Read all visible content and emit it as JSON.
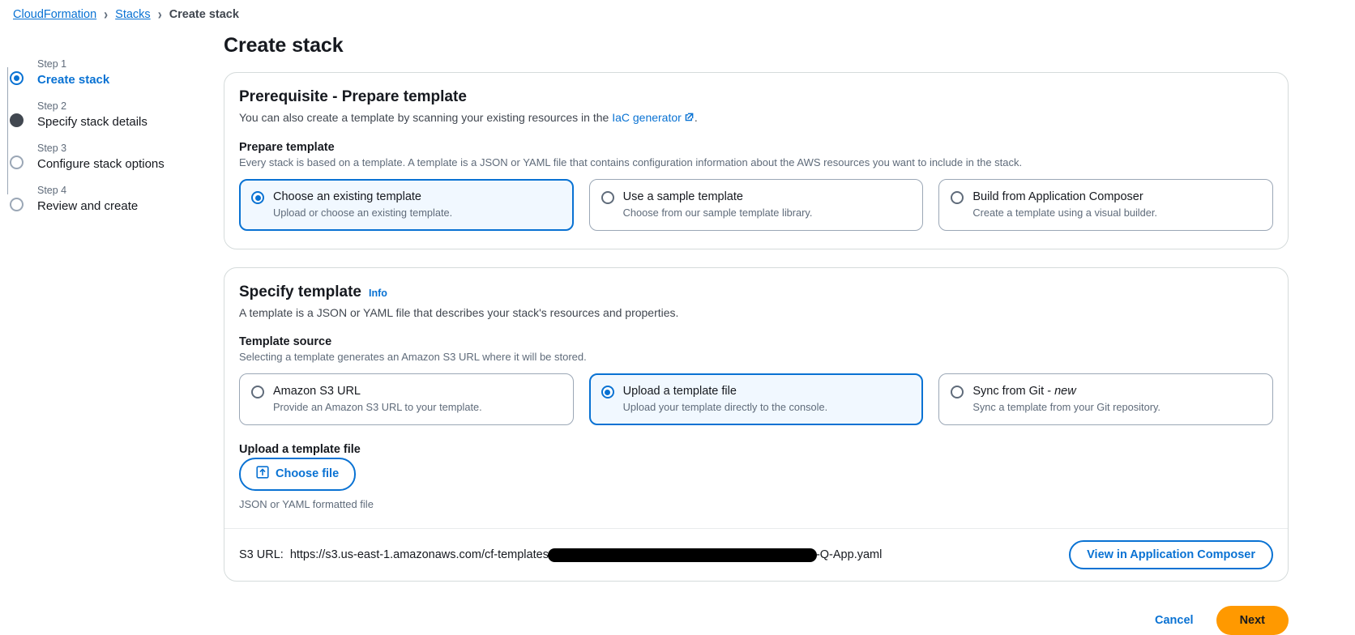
{
  "breadcrumb": {
    "items": [
      {
        "label": "CloudFormation",
        "type": "link"
      },
      {
        "label": "Stacks",
        "type": "link"
      },
      {
        "label": "Create stack",
        "type": "current"
      }
    ],
    "separator": "›"
  },
  "wizard": {
    "steps": [
      {
        "step_label": "Step 1",
        "title": "Create stack",
        "state": "current"
      },
      {
        "step_label": "Step 2",
        "title": "Specify stack details",
        "state": "filled"
      },
      {
        "step_label": "Step 3",
        "title": "Configure stack options",
        "state": "empty"
      },
      {
        "step_label": "Step 4",
        "title": "Review and create",
        "state": "empty"
      }
    ]
  },
  "page": {
    "title": "Create stack"
  },
  "prerequisite": {
    "heading": "Prerequisite - Prepare template",
    "description_before": "You can also create a template by scanning your existing resources in the ",
    "link_text": "IaC generator",
    "description_after": ".",
    "field_label": "Prepare template",
    "field_description": "Every stack is based on a template. A template is a JSON or YAML file that contains configuration information about the AWS resources you want to include in the stack.",
    "options": [
      {
        "title": "Choose an existing template",
        "description": "Upload or choose an existing template.",
        "selected": true
      },
      {
        "title": "Use a sample template",
        "description": "Choose from our sample template library.",
        "selected": false
      },
      {
        "title": "Build from Application Composer",
        "description": "Create a template using a visual builder.",
        "selected": false
      }
    ]
  },
  "specify_template": {
    "heading": "Specify template",
    "info_label": "Info",
    "description": "A template is a JSON or YAML file that describes your stack's resources and properties.",
    "field_label": "Template source",
    "field_description": "Selecting a template generates an Amazon S3 URL where it will be stored.",
    "options": [
      {
        "title": "Amazon S3 URL",
        "title_emphasis": "",
        "description": "Provide an Amazon S3 URL to your template.",
        "selected": false
      },
      {
        "title": "Upload a template file",
        "title_emphasis": "",
        "description": "Upload your template directly to the console.",
        "selected": true
      },
      {
        "title": "Sync from Git - ",
        "title_emphasis": "new",
        "description": "Sync a template from your Git repository.",
        "selected": false
      }
    ],
    "upload": {
      "label": "Upload a template file",
      "button_label": "Choose file",
      "hint": "JSON or YAML formatted file"
    },
    "s3_url": {
      "key_label": "S3 URL:",
      "value_prefix": "https://s3.us-east-1.amazonaws.com/cf-templates",
      "value_redacted": true,
      "value_suffix": "-Q-App.yaml",
      "composer_button": "View in Application Composer"
    }
  },
  "actions": {
    "cancel": "Cancel",
    "next": "Next"
  },
  "colors": {
    "link_blue": "#0972d3",
    "selected_fill": "#f1f8ff",
    "primary_orange": "#ff9900",
    "border_grey": "#d5dbdb",
    "text_dark": "#16191f",
    "text_muted": "#5f6b7a"
  }
}
